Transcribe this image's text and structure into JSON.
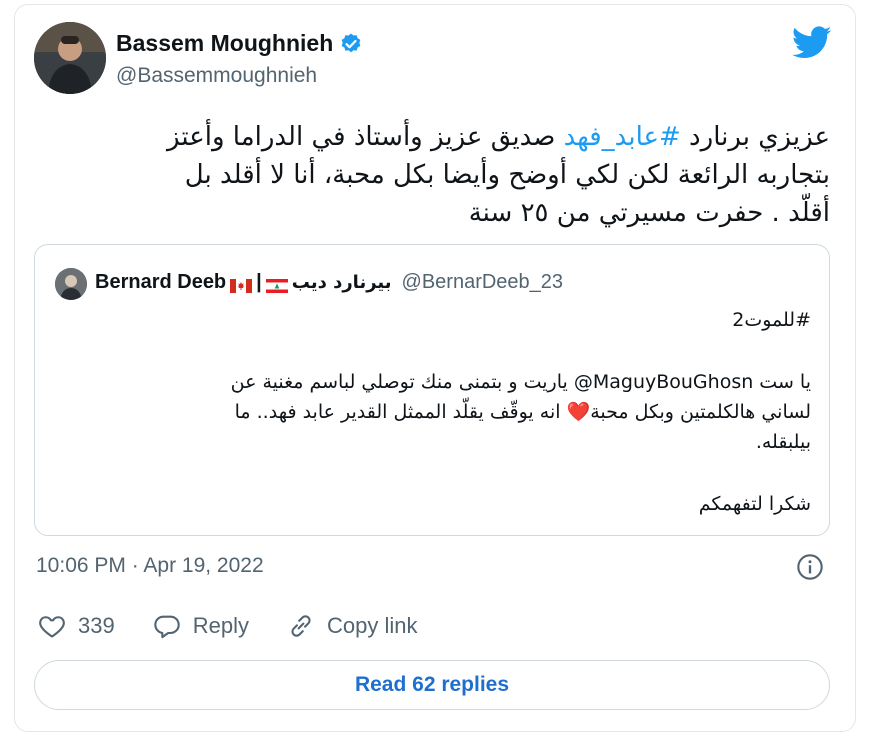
{
  "author": {
    "name": "Bassem Moughnieh",
    "handle": "@Bassemmoughnieh"
  },
  "tweet": {
    "text_line1_before": "عزيزي برنارد ",
    "hashtag": "#عابد_فهد",
    "text_line1_after": " صديق عزيز وأستاذ في الدراما وأعتز",
    "text_line2": "بتجاربه الرائعة لكن لكي أوضح وأيضا بكل محبة، أنا لا أقلد بل",
    "text_line3": "أقلّد . حفرت مسيرتي من ٢٥ سنة"
  },
  "quote": {
    "name": "Bernard Deeb",
    "name_ar": "بيرنارد ديب",
    "separator": "|",
    "handle": "@BernarDeeb_23",
    "line1": "#للموت2",
    "line2": "يا ست MaguyBouGhosn@ ياريت و بتمنى منك توصلي لباسم مغنية عن",
    "line3": "لساني هالكلمتين وبكل محبة❤️ انه يوقّف يقلّد الممثل القدير عابد فهد.. ما",
    "line4": "بيلبقله.",
    "line5": "شكرا لتفهمكم"
  },
  "meta": {
    "timestamp": "10:06 PM · Apr 19, 2022"
  },
  "actions": {
    "likes": "339",
    "reply": "Reply",
    "copy_link": "Copy link"
  },
  "read_replies": "Read 62 replies",
  "colors": {
    "accent": "#1d9bf0",
    "link_button": "#1d6fd0",
    "secondary_text": "#536471",
    "border": "#cfd9de"
  },
  "icons": [
    "verified-badge-icon",
    "twitter-bird-icon",
    "info-icon",
    "heart-icon",
    "reply-icon",
    "link-icon",
    "canada-flag-icon",
    "lebanon-flag-icon"
  ]
}
